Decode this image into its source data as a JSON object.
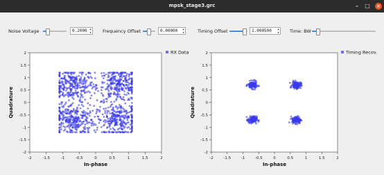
{
  "window": {
    "title": "mpsk_stage3.grc",
    "minimize_glyph": "–",
    "maximize_glyph": "□",
    "close_glyph": "×"
  },
  "controls": {
    "noise_voltage": {
      "label": "Noise Voltage",
      "value": "0.2000",
      "level": 0.2
    },
    "frequency_offset": {
      "label": "Frequency Offset",
      "value": "0.00000",
      "level": 0.5
    },
    "timing_offset": {
      "label": "Timing Offset",
      "value": "1.000500",
      "level": 0.85
    },
    "timing_bw": {
      "label": "Time: BW",
      "level": 0.1
    }
  },
  "chart_data": [
    {
      "type": "scatter",
      "title": "",
      "xlabel": "In-phase",
      "ylabel": "Quadrature",
      "xlim": [
        -2,
        2
      ],
      "ylim": [
        -2,
        2
      ],
      "xticks": [
        "-2",
        "-1.5",
        "-1",
        "-0.5",
        "0",
        "0.5",
        "1",
        "1.5",
        "2"
      ],
      "yticks": [
        "2",
        "1.5",
        "1",
        "0.5",
        "0",
        "-0.5",
        "-1",
        "-1.5",
        "-2"
      ],
      "grid": false,
      "legend_position": "top-right",
      "series": [
        {
          "name": "RX Data",
          "color": "#3b3bef",
          "cluster_centers": [
            [
              -0.7,
              0.7
            ],
            [
              0.7,
              0.7
            ],
            [
              -0.7,
              -0.7
            ],
            [
              0.7,
              -0.7
            ]
          ],
          "cluster_spread": 0.33,
          "x_extent": [
            -1.1,
            1.1
          ],
          "y_extent": [
            -1.2,
            1.2
          ],
          "points_per_cluster": 300
        }
      ]
    },
    {
      "type": "scatter",
      "title": "",
      "xlabel": "In-phase",
      "ylabel": "Quadrature",
      "xlim": [
        -2,
        2
      ],
      "ylim": [
        -2,
        2
      ],
      "xticks": [
        "-2",
        "-1.5",
        "-1",
        "-0.5",
        "0",
        "0.5",
        "1",
        "1.5",
        "2"
      ],
      "yticks": [
        "2",
        "1.5",
        "1",
        "0.5",
        "0",
        "-0.5",
        "-1",
        "-1.5",
        "-2"
      ],
      "grid": false,
      "legend_position": "top-right",
      "series": [
        {
          "name": "Timing Recov.",
          "color": "#3b3bef",
          "cluster_centers": [
            [
              -0.7,
              0.7
            ],
            [
              0.7,
              0.7
            ],
            [
              -0.7,
              -0.7
            ],
            [
              0.7,
              -0.7
            ]
          ],
          "cluster_spread": 0.07,
          "points_per_cluster": 140
        }
      ]
    }
  ]
}
